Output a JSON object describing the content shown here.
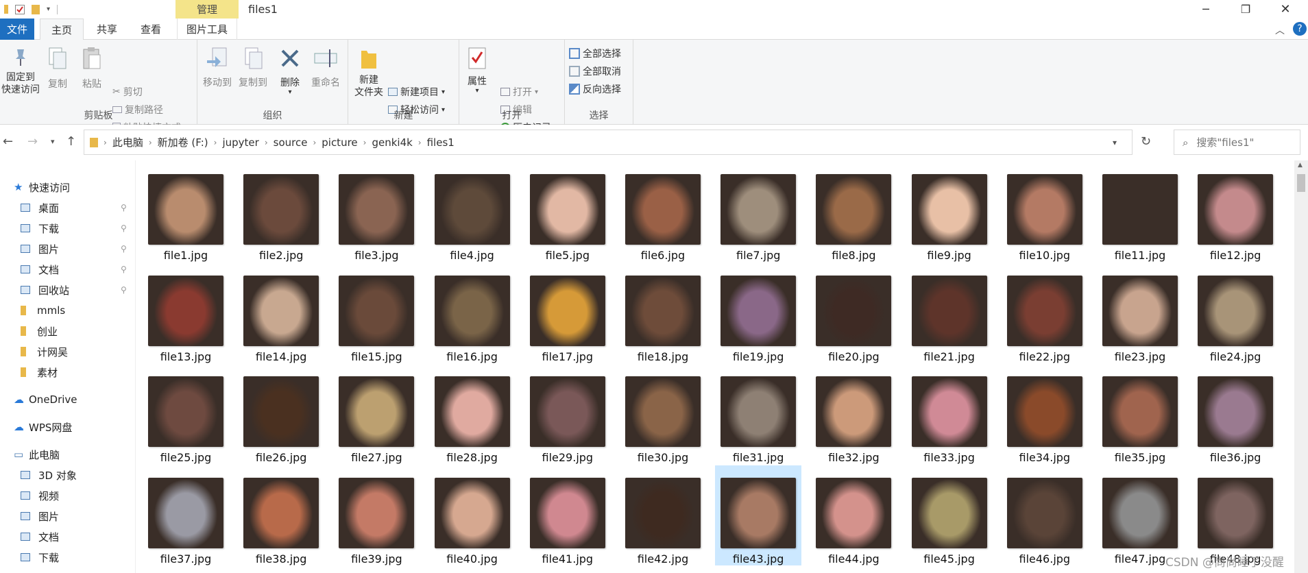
{
  "titlebar": {
    "context_tab": "管理",
    "title": "files1"
  },
  "ribbon_tabs": {
    "file": "文件",
    "home": "主页",
    "share": "共享",
    "view": "查看",
    "picture_tools": "图片工具"
  },
  "ribbon": {
    "clipboard": {
      "label": "剪贴板",
      "pin_line1": "固定到",
      "pin_line2": "快速访问",
      "copy": "复制",
      "paste": "粘贴",
      "cut": "剪切",
      "copy_path": "复制路径",
      "paste_shortcut": "粘贴快捷方式"
    },
    "organize": {
      "label": "组织",
      "move_to": "移动到",
      "copy_to": "复制到",
      "delete": "删除",
      "rename": "重命名"
    },
    "new": {
      "label": "新建",
      "new_folder_line1": "新建",
      "new_folder_line2": "文件夹",
      "new_item": "新建项目",
      "easy_access": "轻松访问"
    },
    "open": {
      "label": "打开",
      "properties": "属性",
      "open": "打开",
      "edit": "编辑",
      "history": "历史记录"
    },
    "select": {
      "label": "选择",
      "select_all": "全部选择",
      "select_none": "全部取消",
      "invert": "反向选择"
    }
  },
  "address": {
    "crumbs": [
      "此电脑",
      "新加卷 (F:)",
      "jupyter",
      "source",
      "picture",
      "genki4k",
      "files1"
    ]
  },
  "search": {
    "placeholder": "搜索\"files1\""
  },
  "sidebar": {
    "quick_access": "快速访问",
    "pinned": [
      {
        "label": "桌面",
        "icon": "desktop-icon"
      },
      {
        "label": "下载",
        "icon": "download-icon"
      },
      {
        "label": "图片",
        "icon": "pictures-icon"
      },
      {
        "label": "文档",
        "icon": "documents-icon"
      },
      {
        "label": "回收站",
        "icon": "recycle-bin-icon"
      }
    ],
    "folders": [
      "mmls",
      "创业",
      "计网吴",
      "素材"
    ],
    "onedrive": "OneDrive",
    "wps": "WPS网盘",
    "this_pc": "此电脑",
    "pc_items": [
      "3D 对象",
      "视频",
      "图片",
      "文档",
      "下载"
    ]
  },
  "files": [
    {
      "name": "file1.jpg",
      "color": "#b98c6e"
    },
    {
      "name": "file2.jpg",
      "color": "#6b4a3c"
    },
    {
      "name": "file3.jpg",
      "color": "#8a6452"
    },
    {
      "name": "file4.jpg",
      "color": "#5e4a3a"
    },
    {
      "name": "file5.jpg",
      "color": "#e2b8a4"
    },
    {
      "name": "file6.jpg",
      "color": "#9a6046"
    },
    {
      "name": "file7.jpg",
      "color": "#9e8e7c"
    },
    {
      "name": "file8.jpg",
      "color": "#9a6a48"
    },
    {
      "name": "file9.jpg",
      "color": "#e8c0a6"
    },
    {
      "name": "file10.jpg",
      "color": "#b47a64"
    },
    {
      "name": "file11.jpg",
      "color": "#3a2e28"
    },
    {
      "name": "file12.jpg",
      "color": "#c48a8c"
    },
    {
      "name": "file13.jpg",
      "color": "#8a3a30"
    },
    {
      "name": "file14.jpg",
      "color": "#c8a890"
    },
    {
      "name": "file15.jpg",
      "color": "#6a4a3a"
    },
    {
      "name": "file16.jpg",
      "color": "#7a6448"
    },
    {
      "name": "file17.jpg",
      "color": "#d69a38"
    },
    {
      "name": "file18.jpg",
      "color": "#6e4c3a"
    },
    {
      "name": "file19.jpg",
      "color": "#8a6888"
    },
    {
      "name": "file20.jpg",
      "color": "#3e2a24"
    },
    {
      "name": "file21.jpg",
      "color": "#5e342a"
    },
    {
      "name": "file22.jpg",
      "color": "#7a3e32"
    },
    {
      "name": "file23.jpg",
      "color": "#c8a48e"
    },
    {
      "name": "file24.jpg",
      "color": "#a89478"
    },
    {
      "name": "file25.jpg",
      "color": "#6e4a40"
    },
    {
      "name": "file26.jpg",
      "color": "#4a3020"
    },
    {
      "name": "file27.jpg",
      "color": "#bca070"
    },
    {
      "name": "file28.jpg",
      "color": "#e0aaa0"
    },
    {
      "name": "file29.jpg",
      "color": "#7a5858"
    },
    {
      "name": "file30.jpg",
      "color": "#8a6448"
    },
    {
      "name": "file31.jpg",
      "color": "#8e8074"
    },
    {
      "name": "file32.jpg",
      "color": "#cc9a7a"
    },
    {
      "name": "file33.jpg",
      "color": "#d08a96"
    },
    {
      "name": "file34.jpg",
      "color": "#8a4a2a"
    },
    {
      "name": "file35.jpg",
      "color": "#a0644e"
    },
    {
      "name": "file36.jpg",
      "color": "#9a7a90"
    },
    {
      "name": "file37.jpg",
      "color": "#9a9aa4"
    },
    {
      "name": "file38.jpg",
      "color": "#b86a4a"
    },
    {
      "name": "file39.jpg",
      "color": "#c47a66"
    },
    {
      "name": "file40.jpg",
      "color": "#d6a890"
    },
    {
      "name": "file41.jpg",
      "color": "#d08890"
    },
    {
      "name": "file42.jpg",
      "color": "#3e2a20"
    },
    {
      "name": "file43.jpg",
      "color": "#a87a64"
    },
    {
      "name": "file44.jpg",
      "color": "#d4928c"
    },
    {
      "name": "file45.jpg",
      "color": "#a89a68"
    },
    {
      "name": "file46.jpg",
      "color": "#5a4438"
    },
    {
      "name": "file47.jpg",
      "color": "#8a8a8a"
    },
    {
      "name": "file48.jpg",
      "color": "#7e6460"
    }
  ],
  "selected_file": "file43.jpg",
  "watermark": "CSDN @尚尚睡了没醒"
}
